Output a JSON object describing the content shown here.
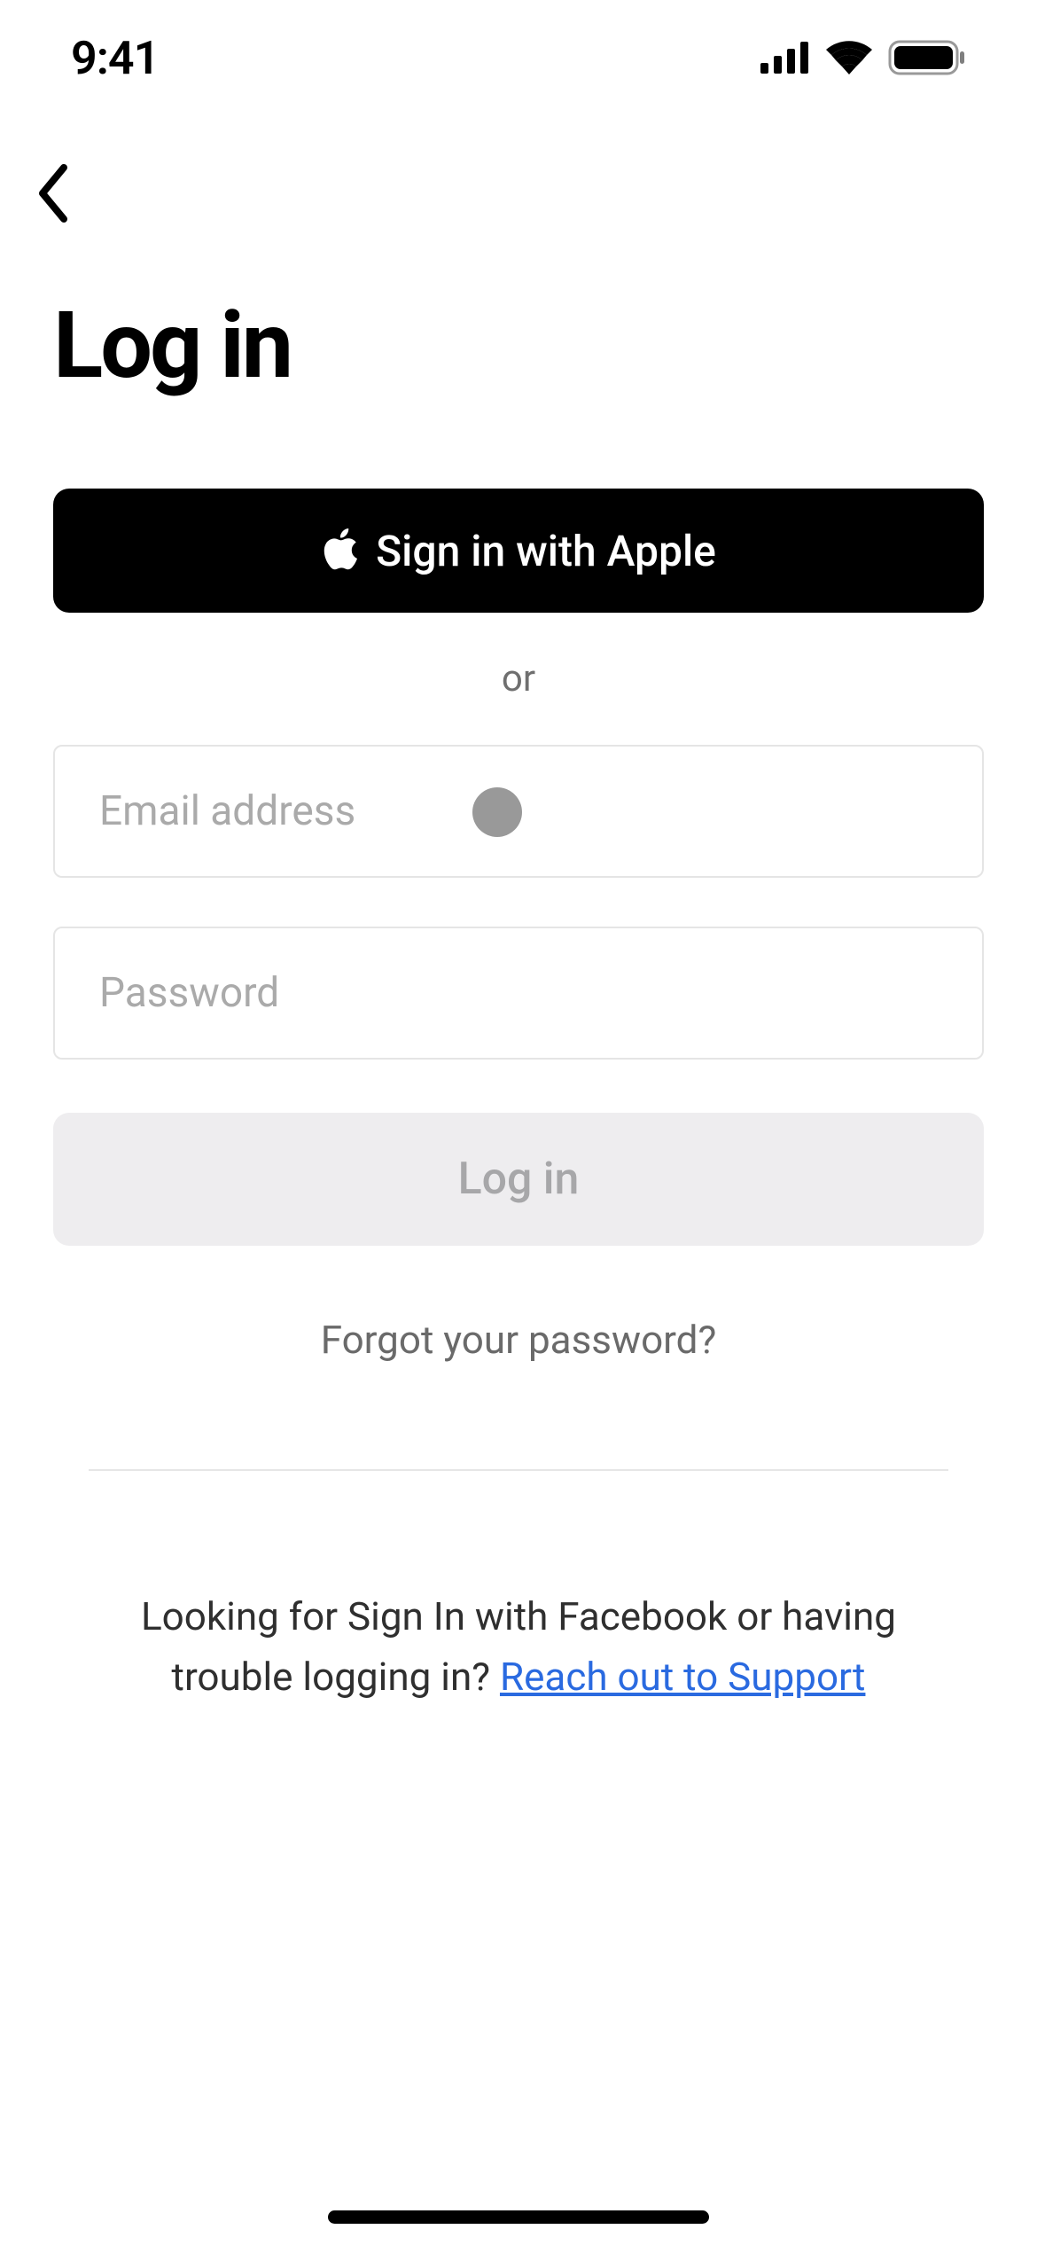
{
  "status": {
    "time": "9:41"
  },
  "page": {
    "title": "Log in"
  },
  "actions": {
    "apple_signin": "Sign in with Apple",
    "divider": "or",
    "login": "Log in",
    "forgot": "Forgot your password?"
  },
  "inputs": {
    "email_placeholder": "Email address",
    "email_value": "",
    "password_placeholder": "Password",
    "password_value": ""
  },
  "help": {
    "prefix": "Looking for Sign In with Facebook or having trouble logging in? ",
    "link": "Reach out to Support"
  }
}
